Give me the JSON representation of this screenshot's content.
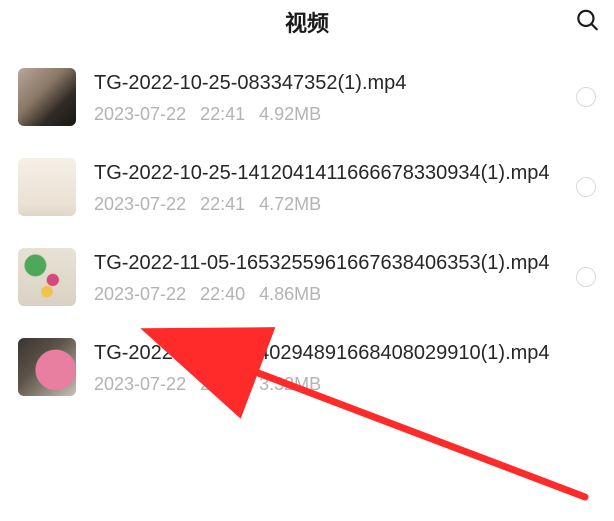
{
  "header": {
    "title": "视频"
  },
  "files": [
    {
      "name": "TG-2022-10-25-083347352(1).mp4",
      "date": "2023-07-22",
      "time": "22:41",
      "size": "4.92MB",
      "thumb_kind": "cat"
    },
    {
      "name": "TG-2022-10-25-1412041411666678330934(1).mp4",
      "date": "2023-07-22",
      "time": "22:41",
      "size": "4.72MB",
      "thumb_kind": "surface"
    },
    {
      "name": "TG-2022-11-05-1653255961667638406353(1).mp4",
      "date": "2023-07-22",
      "time": "22:40",
      "size": "4.86MB",
      "thumb_kind": "flowers"
    },
    {
      "name": "TG-2022-11-14-1440294891668408029910(1).mp4",
      "date": "2023-07-22",
      "time": "22:40",
      "size": "3.32MB",
      "thumb_kind": "bowl"
    }
  ],
  "annotation": {
    "arrow_color": "#ff2a2a"
  }
}
